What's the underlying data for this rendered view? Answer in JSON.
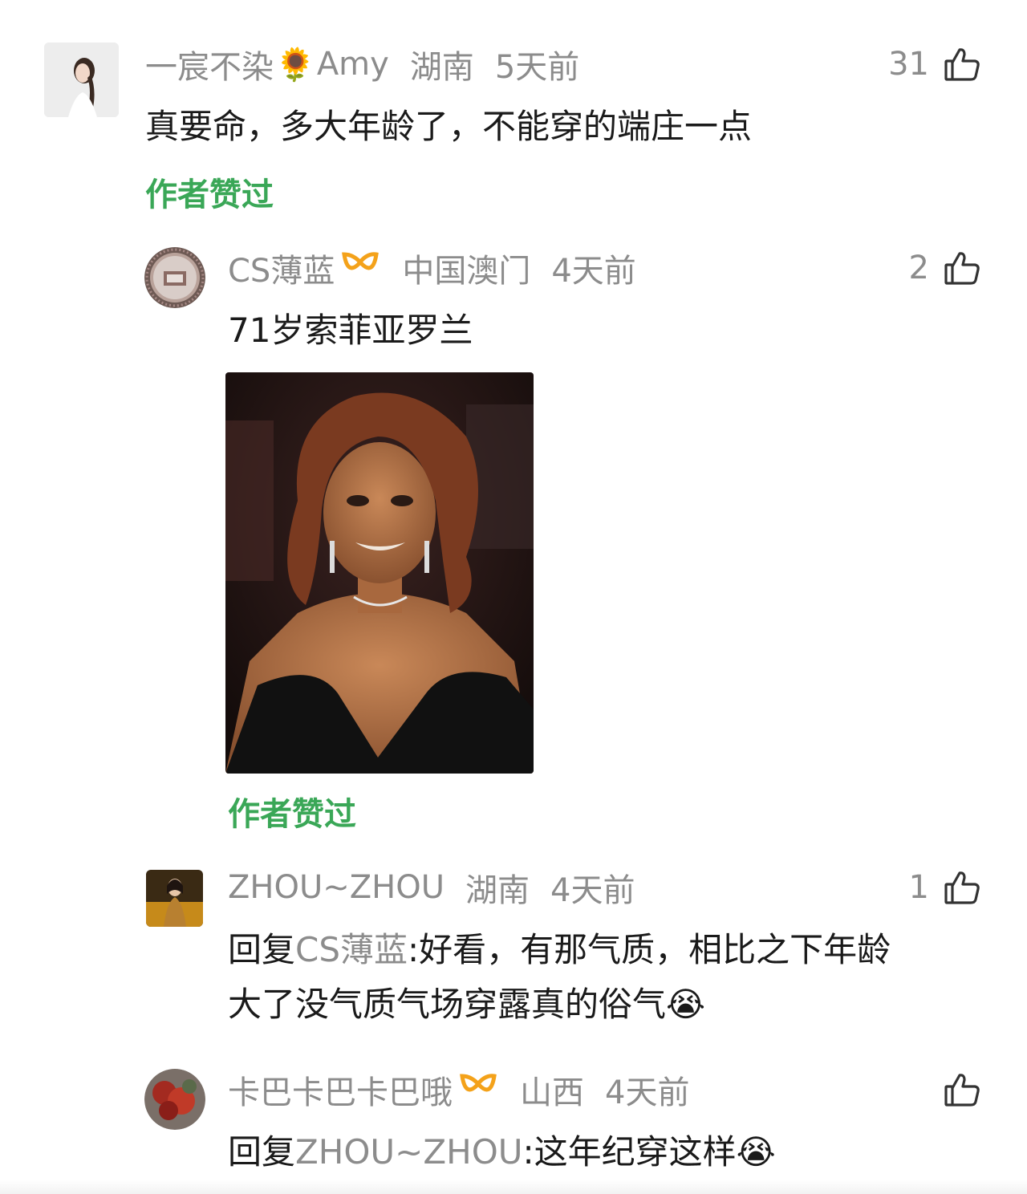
{
  "comments": [
    {
      "username": "一宸不染",
      "username_emoji": "🌻",
      "username_suffix": "Amy",
      "location": "湖南",
      "time": "5天前",
      "likes": "31",
      "text": "真要命，多大年龄了，不能穿的端庄一点",
      "author_liked": "作者赞过"
    },
    {
      "username": "CS薄蓝",
      "location": "中国澳门",
      "time": "4天前",
      "likes": "2",
      "text": "71岁索菲亚罗兰",
      "author_liked": "作者赞过"
    },
    {
      "username": "ZHOU~ZHOU",
      "location": "湖南",
      "time": "4天前",
      "likes": "1",
      "reply_prefix": "回复",
      "reply_to": "CS薄蓝",
      "text_line1": ":好看，有那气质，相比之下年龄",
      "text_line2": "大了没气质气场穿露真的俗气",
      "text_emoji": "😭"
    },
    {
      "username": "卡巴卡巴卡巴哦",
      "location": "山西",
      "time": "4天前",
      "likes": "",
      "reply_prefix": "回复",
      "reply_to": "ZHOU~ZHOU",
      "text": ":这年纪穿这样",
      "text_emoji": "😭"
    }
  ],
  "colors": {
    "meta_gray": "#8c8c8c",
    "author_liked_green": "#3aa757",
    "vip_orange": "#f4a21a"
  }
}
